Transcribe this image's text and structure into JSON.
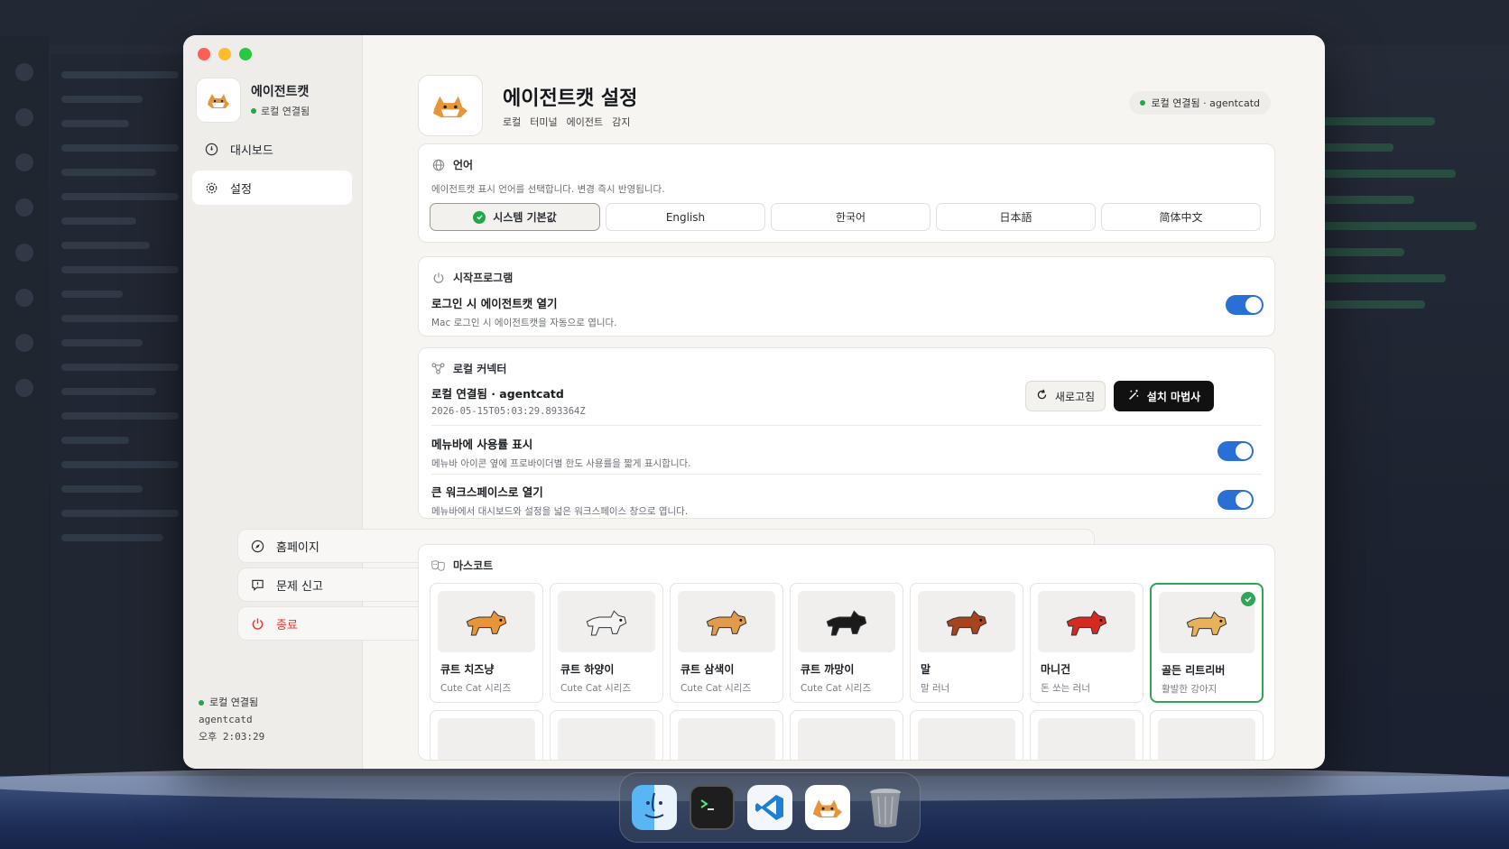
{
  "window": {
    "app_name": "에이전트캣",
    "sidebar_status": "로컬 연결됨",
    "nav": [
      {
        "label": "대시보드"
      },
      {
        "label": "설정"
      }
    ],
    "bottom_nav": [
      {
        "label": "홈페이지"
      },
      {
        "label": "문제 신고"
      },
      {
        "label": "종료"
      }
    ],
    "footer": {
      "status": "로컬 연결됨",
      "daemon": "agentcatd",
      "time": "오후 2:03:29"
    }
  },
  "header": {
    "title": "에이전트캣 설정",
    "tags": [
      "로컬",
      "터미널",
      "에이전트",
      "감지"
    ],
    "connection_badge": "로컬 연결됨 · agentcatd"
  },
  "language": {
    "title": "언어",
    "description": "에이전트캣 표시 언어를 선택합니다. 변경 즉시 반영됩니다.",
    "options": [
      "시스템 기본값",
      "English",
      "한국어",
      "日本語",
      "简体中文"
    ],
    "selected": "시스템 기본값"
  },
  "startup": {
    "title": "시작프로그램",
    "row_title": "로그인 시 에이전트캣 열기",
    "row_desc": "Mac 로그인 시 에이전트캣을 자동으로 엽니다.",
    "enabled": true
  },
  "connector": {
    "title": "로컬 커넥터",
    "status": "로컬 연결됨 · agentcatd",
    "timestamp": "2026-05-15T05:03:29.893364Z",
    "refresh_label": "새로고침",
    "wizard_label": "설치 마법사",
    "menubar_title": "메뉴바에 사용률 표시",
    "menubar_desc": "메뉴바 아이콘 옆에 프로바이더별 한도 사용률을 짧게 표시합니다.",
    "menubar_enabled": true,
    "workspace_title": "큰 워크스페이스로 열기",
    "workspace_desc": "메뉴바에서 대시보드와 설정을 넓은 워크스페이스 창으로 엽니다.",
    "workspace_enabled": true
  },
  "mascot": {
    "title": "마스코트",
    "items": [
      {
        "name": "큐트 치즈냥",
        "sub": "Cute Cat 시리즈",
        "color": "#e8953a"
      },
      {
        "name": "큐트 하양이",
        "sub": "Cute Cat 시리즈",
        "color": "#f4f4f4"
      },
      {
        "name": "큐트 삼색이",
        "sub": "Cute Cat 시리즈",
        "color": "#e39a4a"
      },
      {
        "name": "큐트 까망이",
        "sub": "Cute Cat 시리즈",
        "color": "#1b1b1b"
      },
      {
        "name": "말",
        "sub": "말 러너",
        "color": "#a8431f"
      },
      {
        "name": "마니건",
        "sub": "돈 쏘는 러너",
        "color": "#d42a1f"
      },
      {
        "name": "골든 리트리버",
        "sub": "활발한 강아지",
        "color": "#e8b25a"
      }
    ],
    "selected_index": 6
  },
  "colors": {
    "accent_toggle": "#2a6fd6",
    "success": "#22a84a",
    "quit": "#e03a32"
  },
  "dock": {
    "apps": [
      "finder-icon",
      "terminal-icon",
      "vscode-icon",
      "agentcat-icon",
      "trash-icon"
    ]
  }
}
